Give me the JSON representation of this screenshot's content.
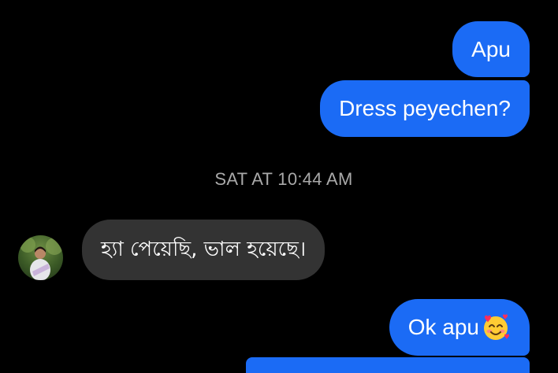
{
  "messages": [
    {
      "text": "Apu",
      "direction": "outgoing"
    },
    {
      "text": "Dress peyechen?",
      "direction": "outgoing"
    },
    {
      "text": "হ্যা পেয়েছি,  ভাল হয়েছে।",
      "direction": "incoming"
    },
    {
      "text": "Ok apu",
      "direction": "outgoing",
      "emoji": "smiling-face-with-hearts"
    }
  ],
  "timestamp": "SAT AT 10:44 AM",
  "colors": {
    "background": "#000000",
    "outgoing_bubble": "#1b6bf5",
    "incoming_bubble": "#333333",
    "timestamp_text": "#a9a9a9",
    "message_text": "#ffffff"
  },
  "icons": {
    "avatar": "contact-avatar-photo",
    "emoji": "smiling-face-with-hearts-icon"
  }
}
